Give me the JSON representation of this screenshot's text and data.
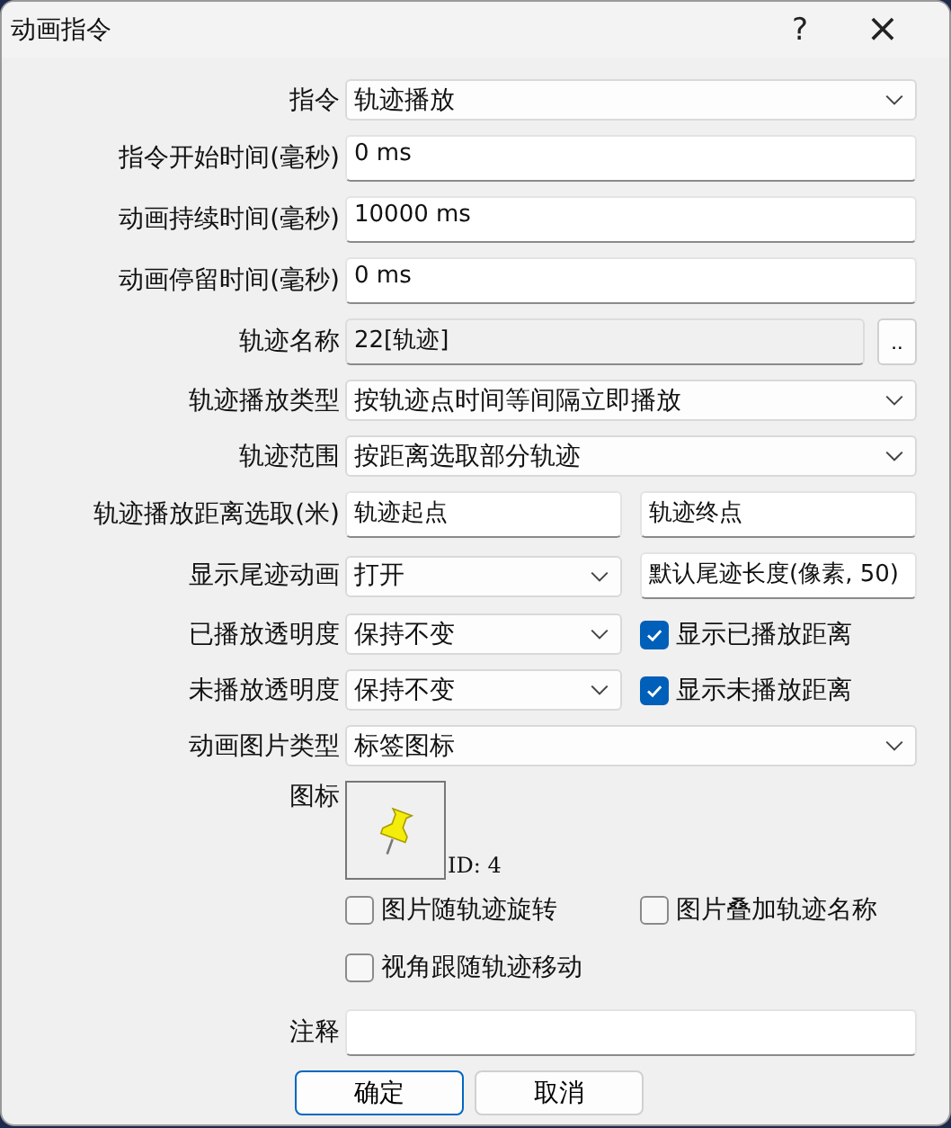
{
  "window": {
    "title": "动画指令",
    "help_button": "?",
    "close_button": "×"
  },
  "rows": [
    {
      "kind": "select",
      "label": "指令",
      "value": "轨迹播放"
    },
    {
      "kind": "text",
      "label": "指令开始时间(毫秒)",
      "value": "0 ms"
    },
    {
      "kind": "text",
      "label": "动画持续时间(毫秒)",
      "value": "10000 ms"
    },
    {
      "kind": "text",
      "label": "动画停留时间(毫秒)",
      "value": "0 ms"
    },
    {
      "kind": "browse",
      "label": "轨迹名称",
      "value": "22[轨迹]",
      "button": ".."
    },
    {
      "kind": "select",
      "label": "轨迹播放类型",
      "value": "按轨迹点时间等间隔立即播放"
    },
    {
      "kind": "select",
      "label": "轨迹范围",
      "value": "按距离选取部分轨迹"
    },
    {
      "kind": "text-pair",
      "label": "轨迹播放距离选取(米)",
      "values": [
        "轨迹起点",
        "轨迹终点"
      ]
    },
    {
      "kind": "select-text",
      "label": "显示尾迹动画",
      "value": "打开",
      "side_value": "默认尾迹长度(像素, 50)"
    },
    {
      "kind": "select-check",
      "label": "已播放透明度",
      "value": "保持不变",
      "check": {
        "label": "显示已播放距离",
        "checked": true
      }
    },
    {
      "kind": "select-check",
      "label": "未播放透明度",
      "value": "保持不变",
      "check": {
        "label": "显示未播放距离",
        "checked": true
      }
    },
    {
      "kind": "select",
      "label": "动画图片类型",
      "value": "标签图标"
    },
    {
      "kind": "icon",
      "label": "图标",
      "id_text": "ID: 4"
    },
    {
      "kind": "checks",
      "checks": [
        {
          "label": "图片随轨迹旋转",
          "checked": false
        },
        {
          "label": "图片叠加轨迹名称",
          "checked": false
        }
      ]
    },
    {
      "kind": "checks",
      "checks": [
        {
          "label": "视角跟随轨迹移动",
          "checked": false
        }
      ]
    },
    {
      "kind": "text",
      "label": "注释"
    }
  ],
  "buttons": [
    {
      "label": "确定",
      "default": true
    },
    {
      "label": "取消",
      "default": false
    }
  ]
}
